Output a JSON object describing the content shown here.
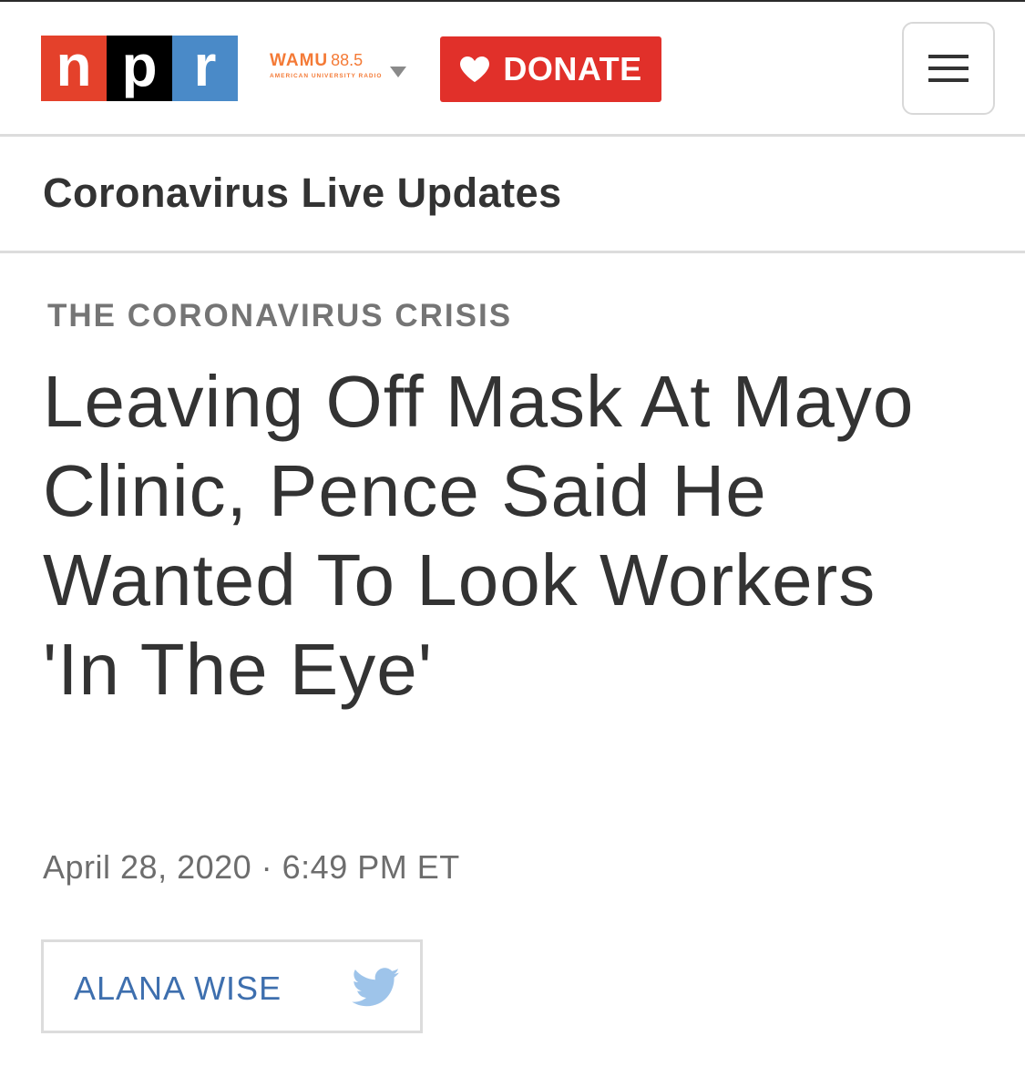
{
  "header": {
    "logo": {
      "n": "n",
      "p": "p",
      "r": "r"
    },
    "station": {
      "call": "WAMU",
      "frequency": "88.5",
      "subtitle": "AMERICAN UNIVERSITY RADIO",
      "icon": "chevron-down-icon"
    },
    "donate": {
      "label": "DONATE",
      "icon": "heart-icon"
    },
    "menu": {
      "icon": "hamburger-menu-icon"
    }
  },
  "section": {
    "title": "Coronavirus Live Updates"
  },
  "article": {
    "slug": "THE CORONAVIRUS CRISIS",
    "headline": "Leaving Off Mask At Mayo Clinic, Pence Said He Wanted To Look Workers 'In The Eye'",
    "dateline": "April 28, 2020 · 6:49 PM ET",
    "byline": {
      "author": "ALANA WISE",
      "icon": "twitter-icon"
    }
  },
  "colors": {
    "npr_red": "#e4412b",
    "npr_black": "#000000",
    "npr_blue": "#4a8ac8",
    "wamu_orange": "#f47a36",
    "donate_red": "#e1302a",
    "byline_blue": "#3e6fae",
    "twitter_blue": "#9ec4ea"
  }
}
